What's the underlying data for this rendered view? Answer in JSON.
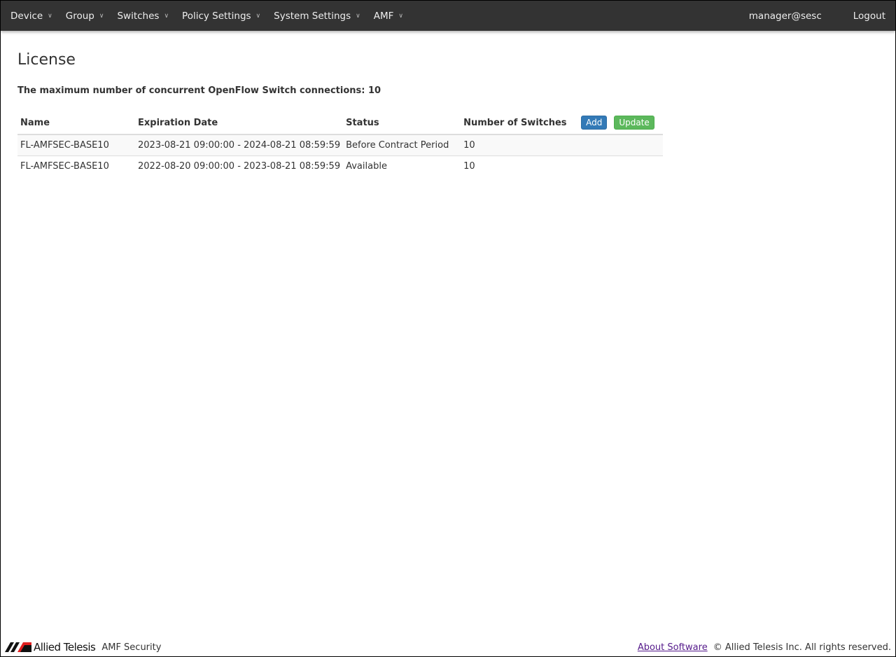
{
  "nav": {
    "items": [
      "Device",
      "Group",
      "Switches",
      "Policy Settings",
      "System Settings",
      "AMF"
    ],
    "user": "manager@sesc",
    "logout": "Logout"
  },
  "page": {
    "title": "License",
    "max_connections": "The maximum number of concurrent OpenFlow Switch connections: 10"
  },
  "table": {
    "headers": [
      "Name",
      "Expiration Date",
      "Status",
      "Number of Switches"
    ],
    "add": "Add",
    "update": "Update",
    "rows": [
      [
        "FL-AMFSEC-BASE10",
        "2023-08-21 09:00:00 - 2024-08-21 08:59:59",
        "Before Contract Period",
        "10"
      ],
      [
        "FL-AMFSEC-BASE10",
        "2022-08-20 09:00:00 - 2023-08-21 08:59:59",
        "Available",
        "10"
      ]
    ]
  },
  "footer": {
    "brand": "Allied Telesis",
    "product": "AMF Security",
    "about": "About Software",
    "copyright": "© Allied Telesis Inc. All rights reserved."
  }
}
